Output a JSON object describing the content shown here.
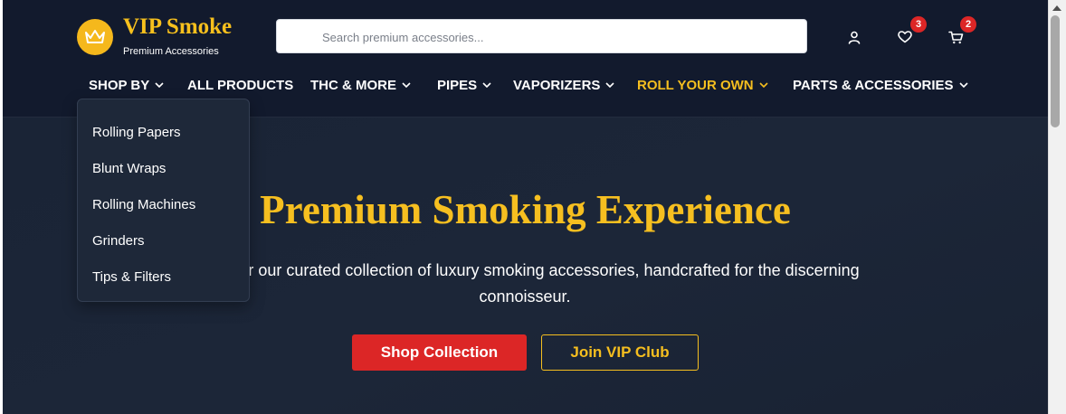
{
  "brand": {
    "name": "VIP Smoke",
    "tagline": "Premium Accessories",
    "logo_icon": "crown-icon",
    "accent_color": "#f5be1f"
  },
  "search": {
    "placeholder": "Search premium accessories...",
    "value": ""
  },
  "header_icons": {
    "account": "user-icon",
    "wishlist": "heart-icon",
    "wishlist_count": "3",
    "cart": "cart-icon",
    "cart_count": "2"
  },
  "nav": {
    "items": [
      {
        "label": "SHOP BY",
        "has_dropdown": true
      },
      {
        "label": "ALL PRODUCTS",
        "has_dropdown": false
      },
      {
        "label": "THC & MORE",
        "has_dropdown": true
      },
      {
        "label": "PIPES",
        "has_dropdown": true
      },
      {
        "label": "VAPORIZERS",
        "has_dropdown": true
      },
      {
        "label": "ROLL YOUR OWN",
        "has_dropdown": true,
        "active": true
      },
      {
        "label": "PARTS & ACCESSORIES",
        "has_dropdown": true
      }
    ]
  },
  "dropdown": {
    "items": [
      "Rolling Papers",
      "Blunt Wraps",
      "Rolling Machines",
      "Grinders",
      "Tips & Filters"
    ]
  },
  "hero": {
    "title": "Premium Smoking Experience",
    "subtitle": "Discover our curated collection of luxury smoking accessories, handcrafted for the discerning connoisseur.",
    "primary_button": "Shop Collection",
    "secondary_button": "Join VIP Club"
  },
  "colors": {
    "header_bg": "#121a2d",
    "hero_bg": "#1c2638",
    "gold": "#f5be1f",
    "red": "#dc2626"
  }
}
